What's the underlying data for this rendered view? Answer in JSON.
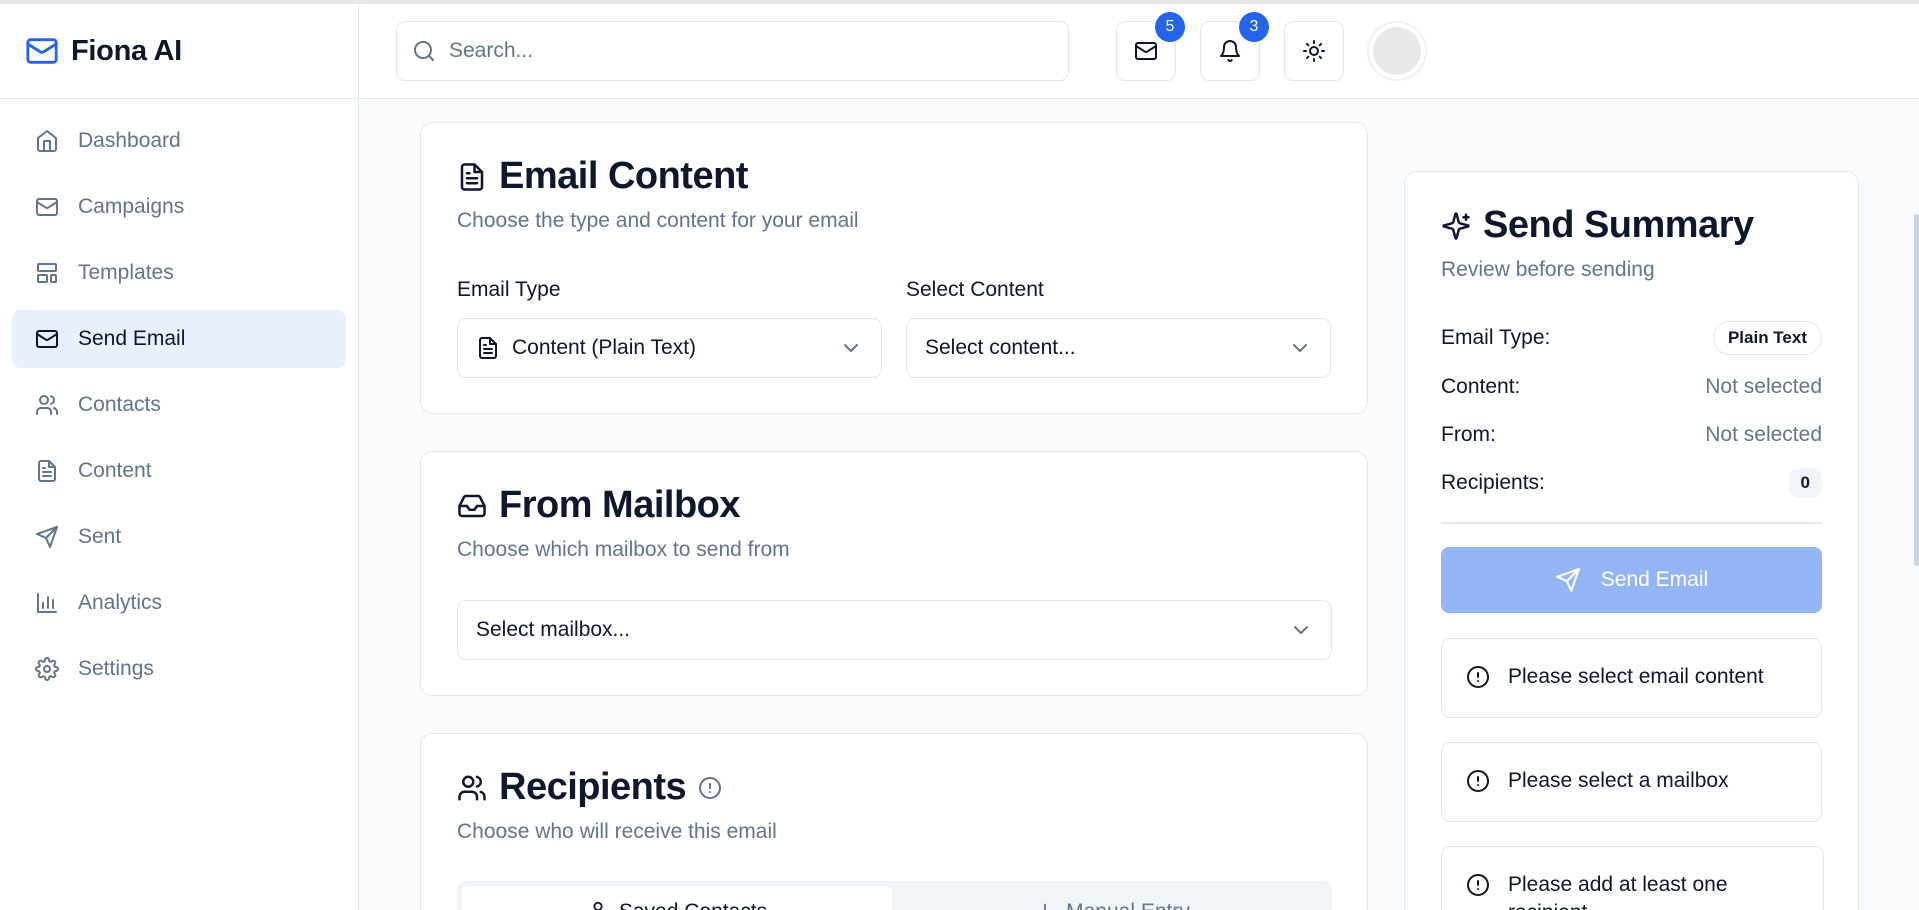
{
  "brand": {
    "name": "Fiona AI",
    "icon": "mail-icon"
  },
  "sidebar": {
    "items": [
      {
        "label": "Dashboard",
        "icon": "home-icon"
      },
      {
        "label": "Campaigns",
        "icon": "mail-icon"
      },
      {
        "label": "Templates",
        "icon": "layout-icon"
      },
      {
        "label": "Send Email",
        "icon": "mail-icon",
        "active": true
      },
      {
        "label": "Contacts",
        "icon": "users-icon"
      },
      {
        "label": "Content",
        "icon": "file-text-icon"
      },
      {
        "label": "Sent",
        "icon": "send-icon"
      },
      {
        "label": "Analytics",
        "icon": "bar-chart-icon"
      },
      {
        "label": "Settings",
        "icon": "gear-icon"
      }
    ]
  },
  "header": {
    "search_placeholder": "Search...",
    "mail_badge": "5",
    "notifications_badge": "3"
  },
  "email_content": {
    "title": "Email Content",
    "subtitle": "Choose the type and content for your email",
    "type_label": "Email Type",
    "type_value": "Content (Plain Text)",
    "content_label": "Select Content",
    "content_value": "Select content..."
  },
  "from_mailbox": {
    "title": "From Mailbox",
    "subtitle": "Choose which mailbox to send from",
    "select_value": "Select mailbox..."
  },
  "recipients": {
    "title": "Recipients",
    "subtitle": "Choose who will receive this email",
    "tabs": [
      "Saved Contacts",
      "Manual Entry"
    ]
  },
  "summary": {
    "title": "Send Summary",
    "subtitle": "Review before sending",
    "rows": [
      {
        "label": "Email Type:",
        "value": "Plain Text"
      },
      {
        "label": "Content:",
        "value": "Not selected"
      },
      {
        "label": "From:",
        "value": "Not selected"
      },
      {
        "label": "Recipients:",
        "value": "0"
      }
    ],
    "send_label": "Send Email",
    "alerts": [
      "Please select email content",
      "Please select a mailbox",
      "Please add at least one recipient"
    ]
  },
  "colors": {
    "accent": "#2563eb",
    "active_nav_bg": "#e8effd",
    "send_disabled": "#93b4f5",
    "muted_text": "#64748b"
  }
}
